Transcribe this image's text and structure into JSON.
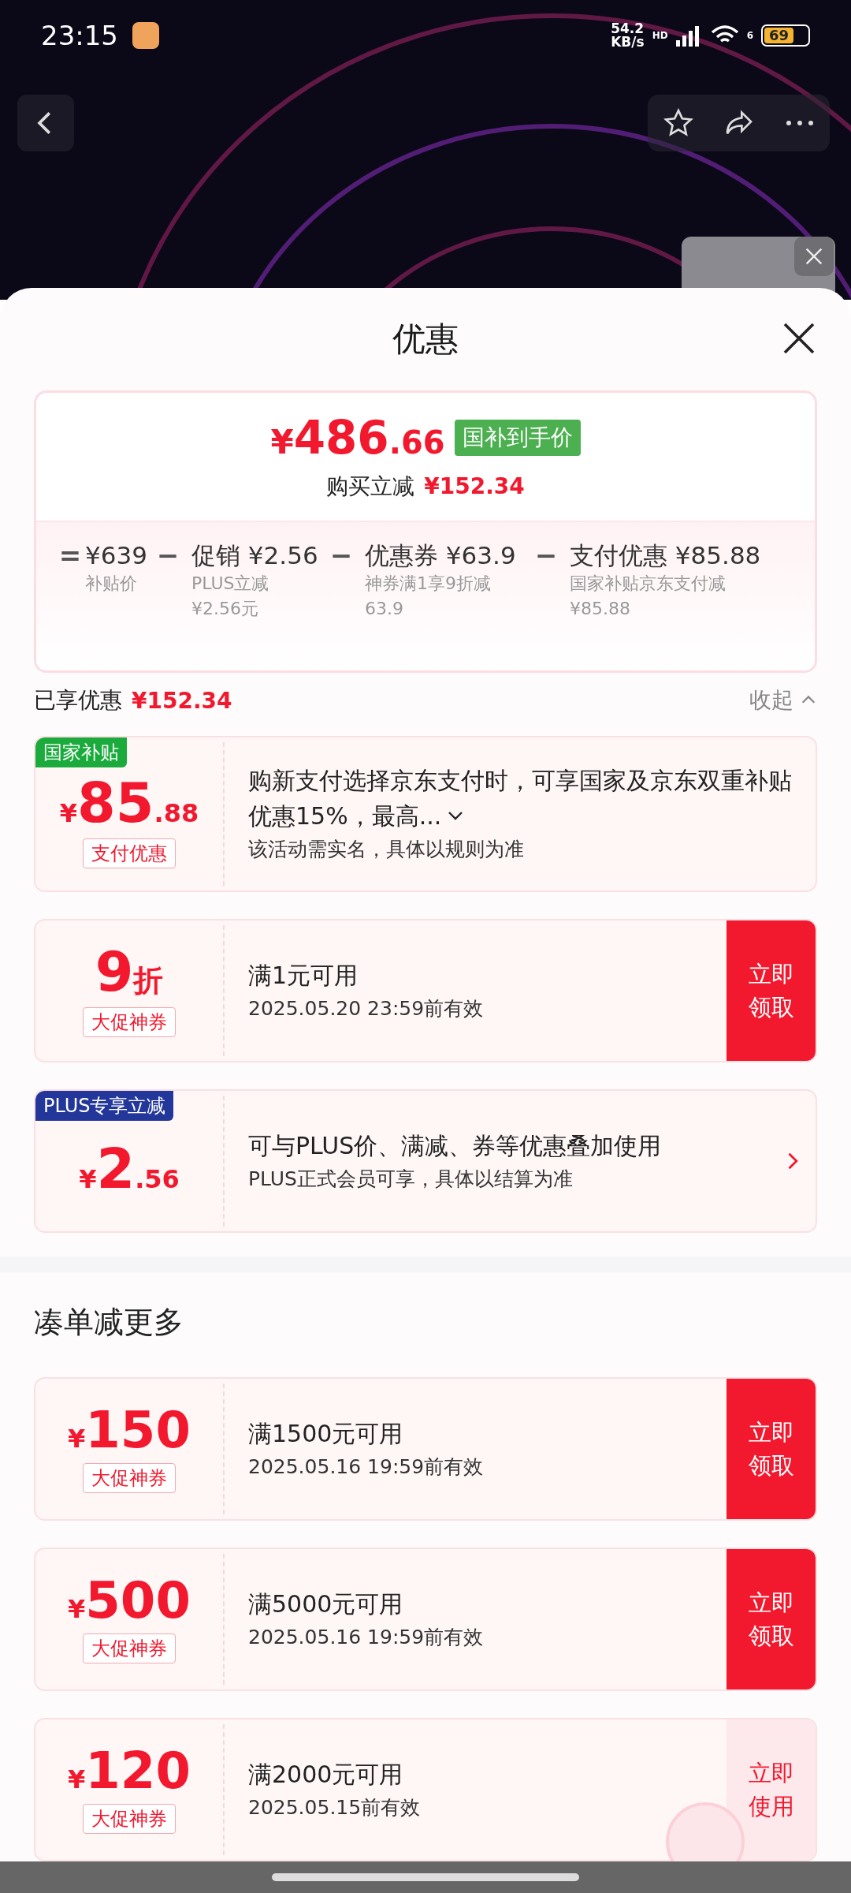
{
  "status_bar": {
    "time": "23:15",
    "net_speed": "54.2",
    "net_unit": "KB/s",
    "signal_label": "HD",
    "wifi_label": "6",
    "battery": "69"
  },
  "sheet": {
    "title": "优惠"
  },
  "price_card": {
    "currency": "¥",
    "price_int": "486",
    "price_dec": ".66",
    "badge": "国补到手价",
    "saving_label": "购买立减",
    "saving_value": "¥152.34",
    "breakdown": [
      {
        "op": "=",
        "value": "¥639",
        "note_lines": [
          "补贴价"
        ]
      },
      {
        "op": "−",
        "value": "促销 ¥2.56",
        "note_lines": [
          "PLUS立减",
          "¥2.56元"
        ]
      },
      {
        "op": "−",
        "value": "优惠券 ¥63.9",
        "note_lines": [
          "神券满1享9折减",
          "63.9"
        ]
      },
      {
        "op": "−",
        "value": "支付优惠 ¥85.88",
        "note_lines": [
          "国家补贴京东支付减",
          "¥85.88"
        ]
      }
    ]
  },
  "applied": {
    "label": "已享优惠",
    "value": "¥152.34",
    "toggle": "收起",
    "expanded": true
  },
  "coupons": [
    {
      "tag": {
        "text": "国家补贴",
        "color": "#1aab3c"
      },
      "prefix": "¥",
      "main": "85",
      "suffix": ".88",
      "label": "支付优惠",
      "title": "购新支付选择京东支付时，可享国家及京东双重补贴优惠15%，最高...",
      "title_expanded": false,
      "subtitle": "该活动需实名，具体以规则为准",
      "action": {
        "kind": "none"
      }
    },
    {
      "main": "9",
      "suffix": "折",
      "label": "大促神券",
      "title": "满1元可用",
      "subtitle": "2025.05.20 23:59前有效",
      "action": {
        "kind": "claim",
        "text": "立即领取"
      }
    },
    {
      "tag": {
        "text": "PLUS专享立减",
        "color": "#23379a"
      },
      "prefix": "¥",
      "main": "2",
      "suffix": ".56",
      "title": "可与PLUS价、满减、券等优惠叠加使用",
      "subtitle": "PLUS正式会员可享，具体以结算为准",
      "action": {
        "kind": "chevron"
      }
    }
  ],
  "more": {
    "title": "凑单减更多",
    "coupons": [
      {
        "prefix": "¥",
        "main": "150",
        "label": "大促神券",
        "title": "满1500元可用",
        "subtitle": "2025.05.16 19:59前有效",
        "action": {
          "kind": "claim",
          "text": "立即领取"
        }
      },
      {
        "prefix": "¥",
        "main": "500",
        "label": "大促神券",
        "title": "满5000元可用",
        "subtitle": "2025.05.16 19:59前有效",
        "action": {
          "kind": "claim",
          "text": "立即领取"
        }
      },
      {
        "prefix": "¥",
        "main": "120",
        "label": "大促神券",
        "title": "满2000元可用",
        "subtitle": "2025.05.15前有效",
        "action": {
          "kind": "use",
          "text": "立即使用"
        }
      }
    ]
  }
}
